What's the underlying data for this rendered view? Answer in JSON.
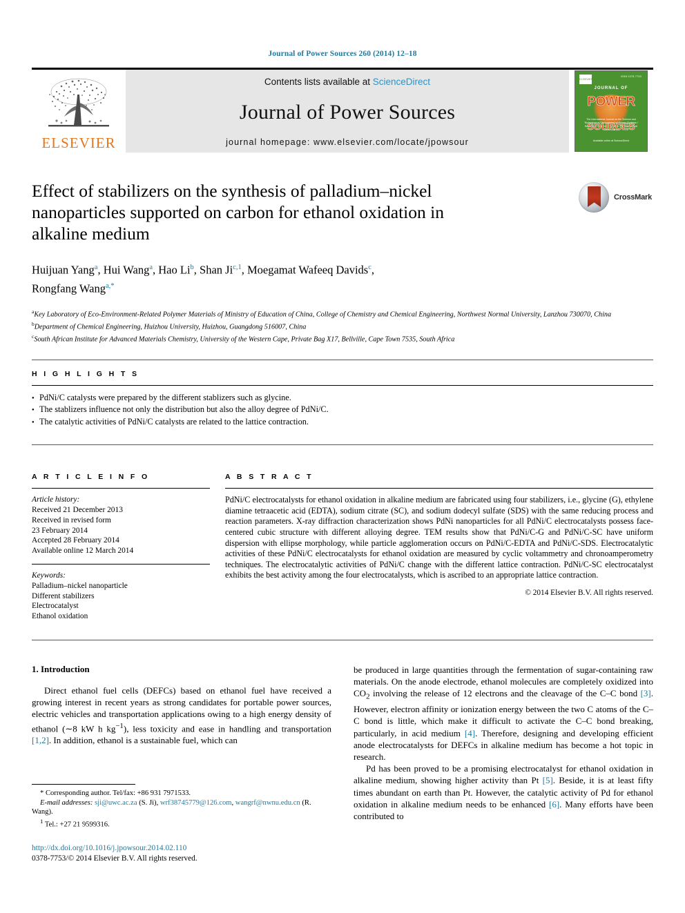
{
  "running_head": "Journal of Power Sources 260 (2014) 12–18",
  "masthead": {
    "contents_text": "Contents lists available at",
    "sciencedirect": "ScienceDirect",
    "journal_name": "Journal of Power Sources",
    "homepage": "journal homepage: www.elsevier.com/locate/jpowsour",
    "publisher": "ELSEVIER",
    "cover": {
      "elsevier_mark": "ELSEVIER",
      "top_tiny": "ISSN 0378-7753",
      "journal_of": "JOURNAL OF",
      "power": "POWER",
      "sources": "SOURCES",
      "subtitle": "The International Journal on the Science and Technology of Electrochemical Energy Systems / Batteries / Fuel Cells and other Electrochemical Power Sources",
      "footer": "Available online at\nScienceDirect"
    },
    "accent_link_color": "#2a93c9",
    "banner_bg": "#e6e6e6",
    "cover_green": "#4b9330"
  },
  "article": {
    "title": "Effect of stabilizers on the synthesis of palladium–nickel nanoparticles supported on carbon for ethanol oxidation in alkaline medium",
    "crossmark_label": "CrossMark",
    "authors_line1": "Huijuan Yang a, Hui Wang a, Hao Li b, Shan Ji c,1, Moegamat Wafeeq Davids c,",
    "authors_line2": "Rongfang Wang a,*",
    "authors": [
      {
        "name": "Huijuan Yang",
        "marks": "a"
      },
      {
        "name": "Hui Wang",
        "marks": "a"
      },
      {
        "name": "Hao Li",
        "marks": "b"
      },
      {
        "name": "Shan Ji",
        "marks": "c,1"
      },
      {
        "name": "Moegamat Wafeeq Davids",
        "marks": "c"
      },
      {
        "name": "Rongfang Wang",
        "marks": "a,*"
      }
    ],
    "affiliations": [
      {
        "mark": "a",
        "text": "Key Laboratory of Eco-Environment-Related Polymer Materials of Ministry of Education of China, College of Chemistry and Chemical Engineering, Northwest Normal University, Lanzhou 730070, China"
      },
      {
        "mark": "b",
        "text": "Department of Chemical Engineering, Huizhou University, Huizhou, Guangdong 516007, China"
      },
      {
        "mark": "c",
        "text": "South African Institute for Advanced Materials Chemistry, University of the Western Cape, Private Bag X17, Bellville, Cape Town 7535, South Africa"
      }
    ]
  },
  "highlights": {
    "label": "H I G H L I G H T S",
    "items": [
      "PdNi/C catalysts were prepared by the different stablizers such as glycine.",
      "The stablizers influence not only the distribution but also the alloy degree of PdNi/C.",
      "The catalytic activities of PdNi/C catalysts are related to the lattice contraction."
    ]
  },
  "article_info": {
    "label": "A R T I C L E    I N F O",
    "history_heading": "Article history:",
    "history": [
      "Received 21 December 2013",
      "Received in revised form",
      "23 February 2014",
      "Accepted 28 February 2014",
      "Available online 12 March 2014"
    ],
    "keywords_heading": "Keywords:",
    "keywords": [
      "Palladium–nickel nanoparticle",
      "Different stabilizers",
      "Electrocatalyst",
      "Ethanol oxidation"
    ]
  },
  "abstract": {
    "label": "A B S T R A C T",
    "text": "PdNi/C electrocatalysts for ethanol oxidation in alkaline medium are fabricated using four stabilizers, i.e., glycine (G), ethylene diamine tetraacetic acid (EDTA), sodium citrate (SC), and sodium dodecyl sulfate (SDS) with the same reducing process and reaction parameters. X-ray diffraction characterization shows PdNi nanoparticles for all PdNi/C electrocatalysts possess face-centered cubic structure with different alloying degree. TEM results show that PdNi/C-G and PdNi/C-SC have uniform dispersion with ellipse morphology, while particle agglomeration occurs on PdNi/C-EDTA and PdNi/C-SDS. Electrocatalytic activities of these PdNi/C electrocatalysts for ethanol oxidation are measured by cyclic voltammetry and chronoamperometry techniques. The electrocatalytic activities of PdNi/C change with the different lattice contraction. PdNi/C-SC electrocatalyst exhibits the best activity among the four electrocatalysts, which is ascribed to an appropriate lattice contraction.",
    "copyright": "© 2014 Elsevier B.V. All rights reserved."
  },
  "body": {
    "section_number_title": "1.  Introduction",
    "left_paragraph_1_a": "Direct ethanol fuel cells (DEFCs) based on ethanol fuel have received a growing interest in recent years as strong candidates for portable power sources, electric vehicles and transportation applications owing to a high energy density of ethanol (∼8 kW h kg",
    "left_paragraph_1_sup": "−1",
    "left_paragraph_1_b": "), less toxicity and ease in handling and transportation ",
    "left_ref_1": "[1,2]",
    "left_paragraph_1_c": ". In addition, ethanol is a sustainable fuel, which can",
    "right_paragraph_1_a": "be produced in large quantities through the fermentation of sugar-containing raw materials. On the anode electrode, ethanol molecules are completely oxidized into CO",
    "right_paragraph_1_sub": "2",
    "right_paragraph_1_b": " involving the release of 12 electrons and the cleavage of the C–C bond ",
    "right_ref_3": "[3]",
    "right_paragraph_1_c": ". However, electron affinity or ionization energy between the two C atoms of the C–C bond is little, which make it difficult to activate the C–C bond breaking, particularly, in acid medium ",
    "right_ref_4": "[4]",
    "right_paragraph_1_d": ". Therefore, designing and developing efficient anode electrocatalysts for DEFCs in alkaline medium has become a hot topic in research.",
    "right_paragraph_2_a": "Pd has been proved to be a promising electrocatalyst for ethanol oxidation in alkaline medium, showing higher activity than Pt ",
    "right_ref_5": "[5]",
    "right_paragraph_2_b": ". Beside, it is at least fifty times abundant on earth than Pt. However, the catalytic activity of Pd for ethanol oxidation in alkaline medium needs to be enhanced ",
    "right_ref_6": "[6]",
    "right_paragraph_2_c": ". Many efforts have been contributed to"
  },
  "footnotes": {
    "corresponding": "* Corresponding author. Tel/fax: +86 931 7971533.",
    "email_label": "E-mail addresses:",
    "email_1": "sji@uwc.ac.za",
    "email_1_owner": "(S. Ji),",
    "email_2": "wrf38745779@126.com",
    "email_3": "wangrf@nwnu.edu.cn",
    "email_3_owner": "(R. Wang).",
    "tel_mark": "1",
    "tel": "Tel.: +27 21 9599316.",
    "doi": "http://dx.doi.org/10.1016/j.jpowsour.2014.02.110",
    "issn_line": "0378-7753/© 2014 Elsevier B.V. All rights reserved.",
    "link_color": "#1f7a9e"
  }
}
